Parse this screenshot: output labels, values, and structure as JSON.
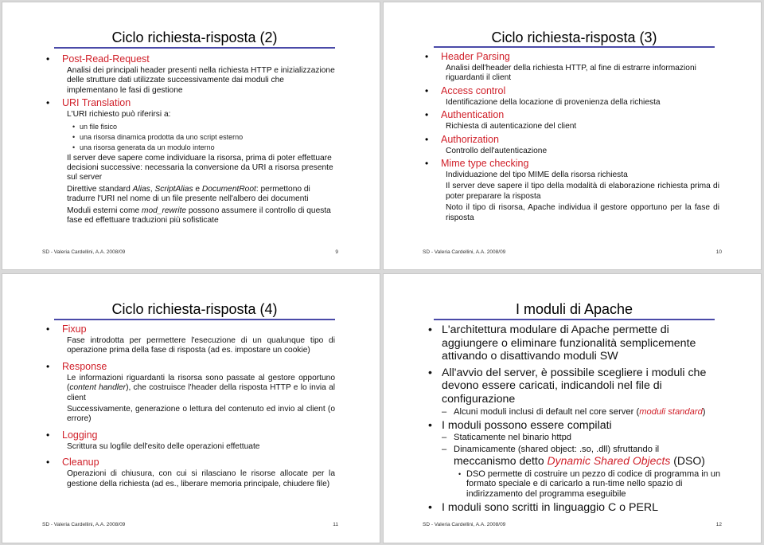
{
  "footer_author": "SD - Valeria Cardellini, A.A. 2008/09",
  "colors": {
    "accent_red": "#d0202a",
    "title_rule": "#4a4aa8"
  },
  "slides": [
    {
      "number": "9",
      "title": "Ciclo richiesta-risposta (2)",
      "items": [
        {
          "heading": "Post-Read-Request",
          "paragraphs": [
            "Analisi dei principali header presenti nella richiesta HTTP e inizializzazione delle strutture dati utilizzate successivamente dai moduli che implementano le fasi di gestione"
          ]
        },
        {
          "heading": "URI Translation",
          "intro": "L'URI richiesto può riferirsi a:",
          "subitems": [
            "un file fisico",
            "una risorsa dinamica prodotta da uno script esterno",
            "una risorsa generata da un modulo interno"
          ],
          "p1": "Il server deve sapere come individuare la risorsa, prima di poter effettuare decisioni successive: necessaria la conversione da URI a risorsa presente sul server",
          "p2": {
            "a": "Direttive standard ",
            "i1": "Alias",
            "b": ", ",
            "i2": "ScriptAlias",
            "c": " e ",
            "i3": "DocumentRoot",
            "d": ": permettono di tradurre l'URI nel nome di un file presente nell'albero dei documenti"
          },
          "p3": {
            "a": "Moduli esterni come ",
            "i1": "mod_rewrite",
            "b": " possono assumere il controllo di questa fase ed effettuare traduzioni più sofisticate"
          }
        }
      ]
    },
    {
      "number": "10",
      "title": "Ciclo richiesta-risposta (3)",
      "items": [
        {
          "heading": "Header Parsing",
          "text": "Analisi dell'header della richiesta HTTP, al fine di estrarre informazioni riguardanti il client"
        },
        {
          "heading": "Access control",
          "text": "Identificazione della locazione di provenienza della richiesta"
        },
        {
          "heading": "Authentication",
          "text": "Richiesta di autenticazione del client"
        },
        {
          "heading": "Authorization",
          "text": "Controllo dell'autenticazione"
        },
        {
          "heading": "Mime type checking",
          "text": "Individuazione del tipo MIME della risorsa richiesta",
          "text2": "Il server deve sapere il tipo della modalità di elaborazione richiesta prima di poter preparare la risposta",
          "text3": "Noto il tipo di risorsa, Apache individua il gestore opportuno per la fase di risposta"
        }
      ]
    },
    {
      "number": "11",
      "title": "Ciclo richiesta-risposta (4)",
      "items": [
        {
          "heading": "Fixup",
          "text": "Fase introdotta per permettere l'esecuzione di un qualunque tipo di operazione prima della fase di risposta (ad es. impostare un cookie)"
        },
        {
          "heading": "Response",
          "t1a": "Le informazioni riguardanti la risorsa sono passate al gestore opportuno (",
          "t1i": "content handler",
          "t1b": "), che costruisce l'header della risposta HTTP e lo invia al client",
          "text2": "Successivamente, generazione o lettura del contenuto ed invio al client (o errore)"
        },
        {
          "heading": "Logging",
          "text": "Scrittura su logfile dell'esito delle operazioni effettuate"
        },
        {
          "heading": "Cleanup",
          "text": "Operazioni di chiusura, con cui si rilasciano le risorse allocate per la gestione della richiesta (ad es., liberare memoria principale, chiudere file)"
        }
      ]
    },
    {
      "number": "12",
      "title": "I moduli di Apache",
      "b1": "L'architettura modulare di Apache permette di aggiungere o eliminare funzionalità semplicemente attivando o disattivando moduli SW",
      "b2": "All'avvio del server, è possibile scegliere i moduli che devono essere caricati, indicandoli nel file di configurazione",
      "b2_sub_a": "Alcuni moduli inclusi di default nel core server (",
      "b2_sub_i": "moduli standard",
      "b2_sub_b": ")",
      "b3": "I moduli possono essere compilati",
      "b3_sub1": "Staticamente nel binario httpd",
      "b3_sub2_a": "Dinamicamente (shared object: .so, .dll) sfruttando il",
      "b3_sub2_b": "meccanismo detto ",
      "b3_sub2_i": "Dynamic Shared Objects",
      "b3_sub2_c": " (DSO)",
      "b3_sub2_sub": "DSO permette di costruire un pezzo di codice di programma in un formato speciale e di caricarlo a run-time nello spazio di indirizzamento del programma eseguibile",
      "b4": "I moduli sono scritti in linguaggio C o PERL"
    }
  ]
}
